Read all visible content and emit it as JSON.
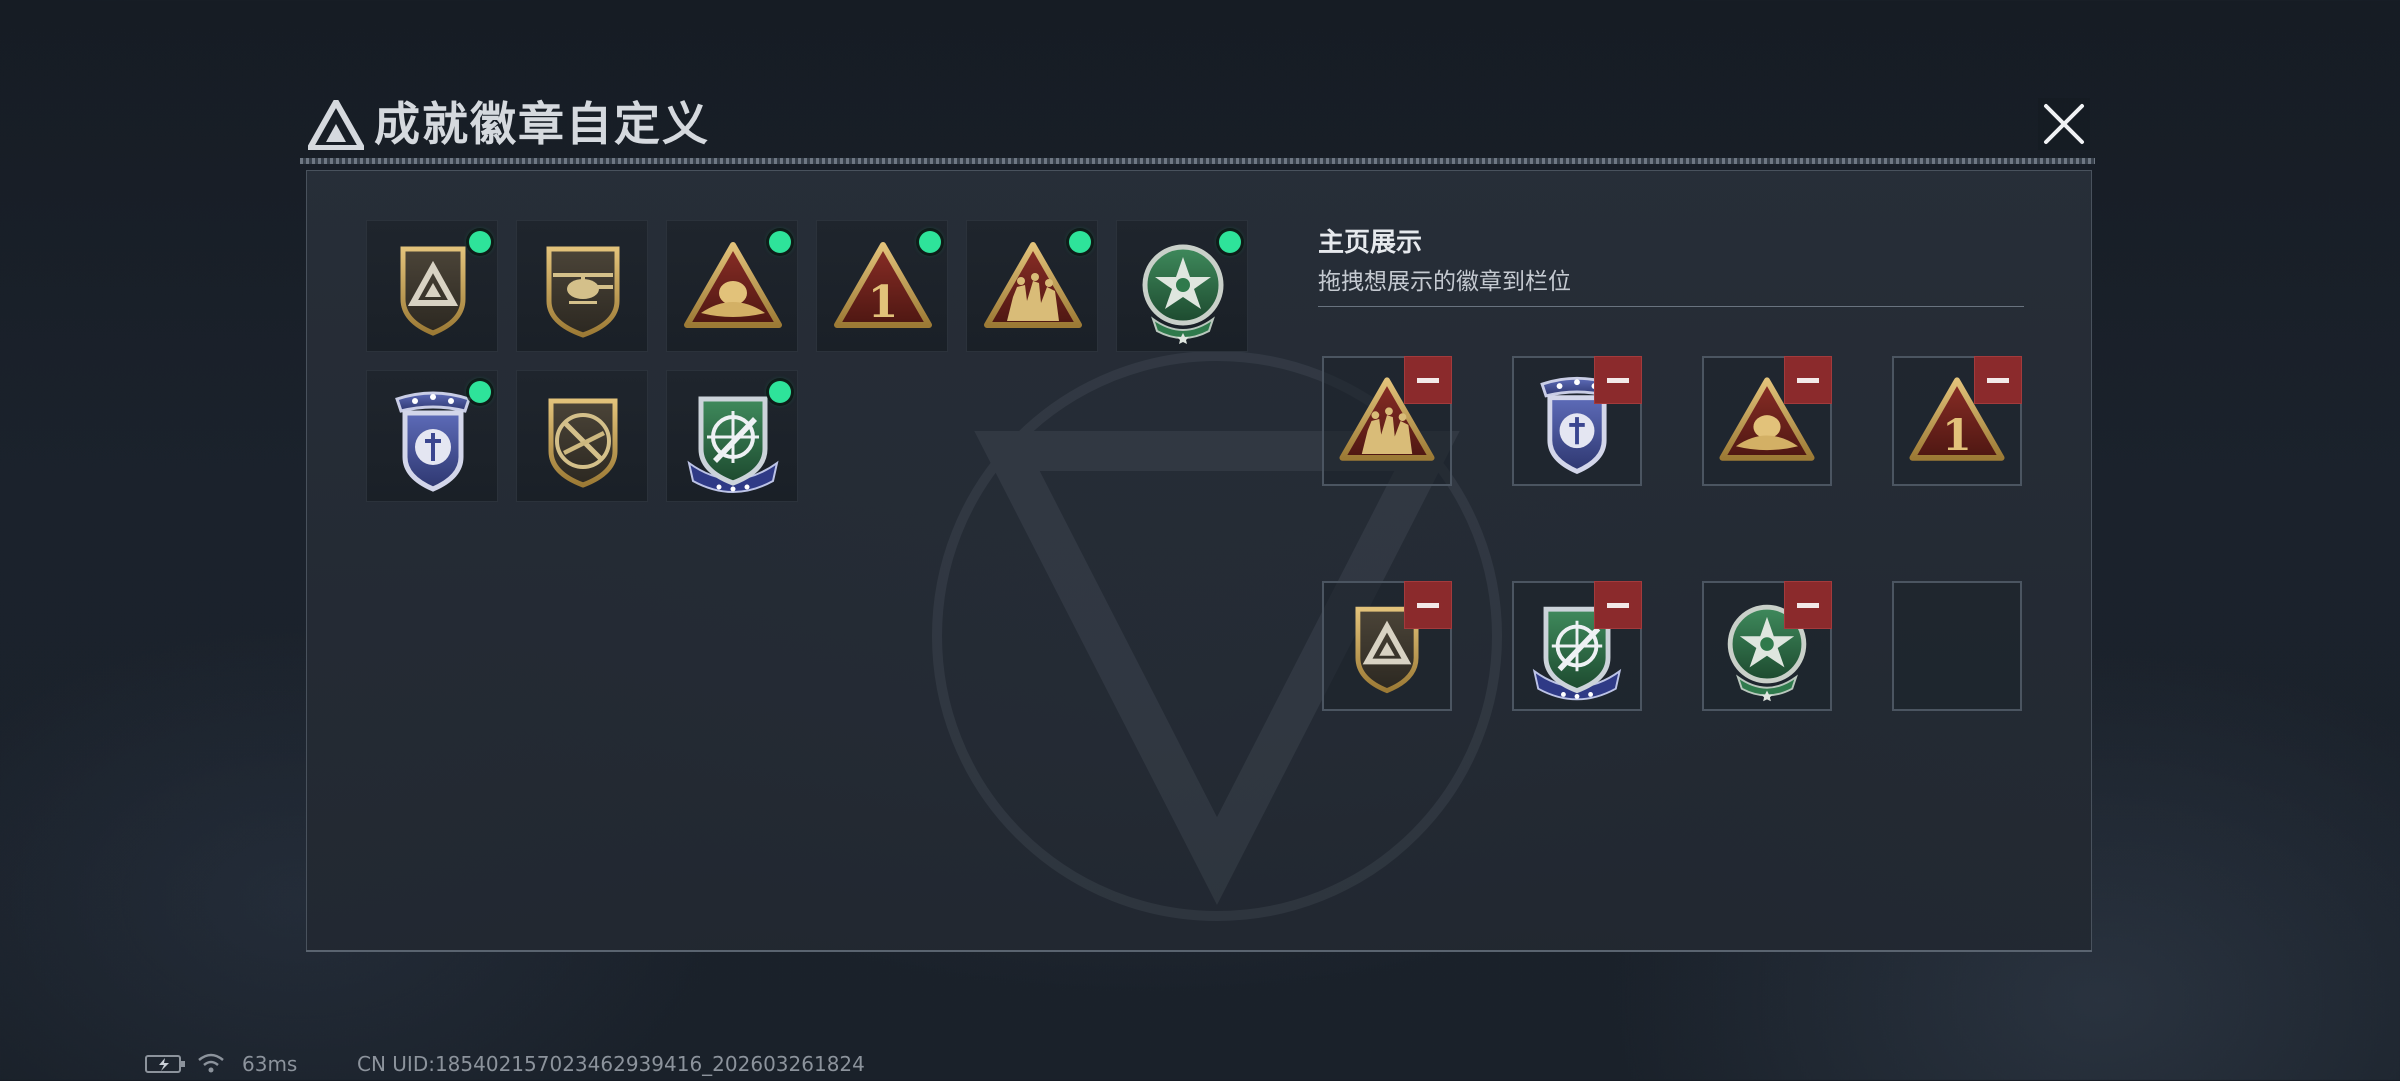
{
  "dialog": {
    "title": "成就徽章自定义"
  },
  "badge_inventory": [
    {
      "name": "triangle-shield-badge",
      "owned": true
    },
    {
      "name": "helicopter-shield-badge",
      "owned": false
    },
    {
      "name": "egg-nest-triangle-badge",
      "owned": true
    },
    {
      "name": "number-one-triangle-badge",
      "owned": true
    },
    {
      "name": "soldiers-triangle-badge",
      "owned": true
    },
    {
      "name": "green-star-wreath-badge",
      "owned": true
    },
    {
      "name": "blue-police-shield-badge",
      "owned": true
    },
    {
      "name": "rifle-prohibited-shield-badge",
      "owned": false
    },
    {
      "name": "crosshair-rocket-shield-badge",
      "owned": true
    }
  ],
  "showcase": {
    "title": "主页展示",
    "subtitle": "拖拽想展示的徽章到栏位",
    "slots": [
      {
        "badge": "soldiers-triangle-badge"
      },
      {
        "badge": "blue-police-shield-badge"
      },
      {
        "badge": "egg-nest-triangle-badge"
      },
      {
        "badge": "number-one-triangle-badge"
      },
      {
        "badge": "triangle-shield-badge"
      },
      {
        "badge": "crosshair-rocket-shield-badge"
      },
      {
        "badge": "green-star-wreath-badge"
      },
      {
        "badge": ""
      }
    ]
  },
  "status_bar": {
    "ping": "63ms",
    "uid": "CN UID:18540215702346293​9416_202603261824"
  },
  "colors": {
    "owned_indicator": "#2ee39a",
    "remove_button": "#8b2a2c",
    "gold": "#c9a24f"
  }
}
